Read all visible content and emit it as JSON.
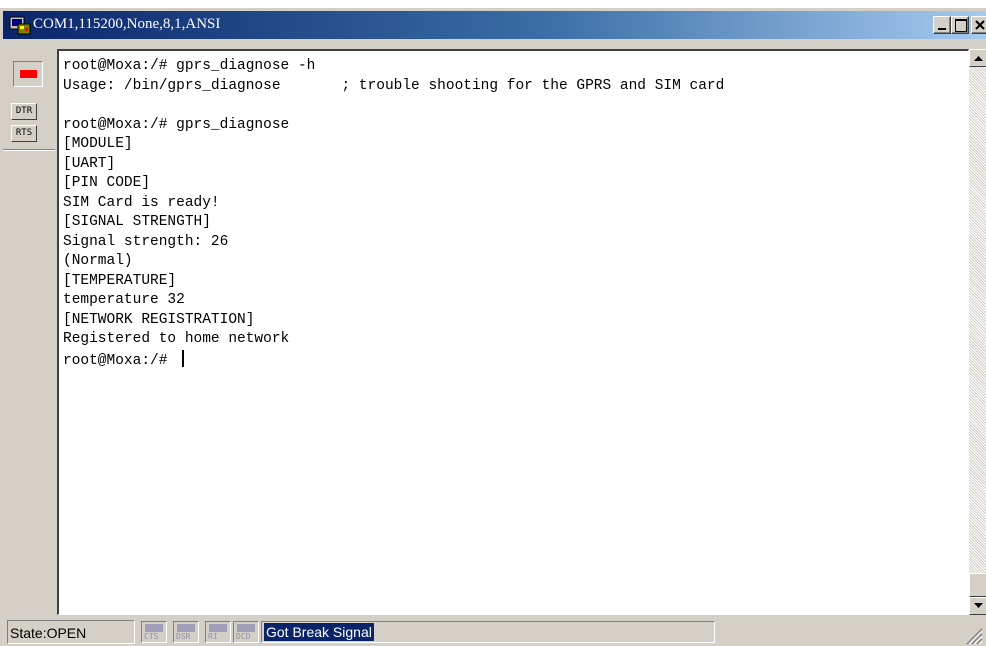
{
  "window": {
    "title": "COM1,115200,None,8,1,ANSI",
    "app_icon": "terminal-app-icon",
    "caption_buttons": [
      "minimize",
      "maximize",
      "close"
    ]
  },
  "left_toolbar": {
    "led_color": "#ff0000",
    "buttons": [
      {
        "label": "DTR"
      },
      {
        "label": "RTS"
      }
    ]
  },
  "terminal": {
    "lines": [
      "root@Moxa:/# gprs_diagnose -h",
      "Usage: /bin/gprs_diagnose       ; trouble shooting for the GPRS and SIM card",
      "",
      "root@Moxa:/# gprs_diagnose",
      "[MODULE]",
      "[UART]",
      "[PIN CODE]",
      "SIM Card is ready!",
      "[SIGNAL STRENGTH]",
      "Signal strength: 26",
      "(Normal)",
      "[TEMPERATURE]",
      "temperature 32",
      "[NETWORK REGISTRATION]",
      "Registered to home network",
      "root@Moxa:/# "
    ]
  },
  "status_bar": {
    "state": "State:OPEN",
    "signals": [
      "CTS",
      "DSR",
      "RI",
      "DCD"
    ],
    "message": "Got Break Signal"
  },
  "colors": {
    "titlebar_start": "#0a246a",
    "chrome": "#d4d0c8",
    "highlight": "#0a246a"
  }
}
